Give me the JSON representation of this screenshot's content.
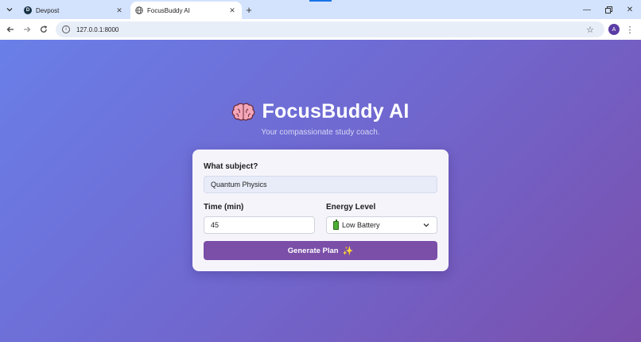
{
  "browser": {
    "tabs": [
      {
        "title": "Devpost",
        "favicon": "devpost-icon"
      },
      {
        "title": "FocusBuddy AI",
        "favicon": "globe-icon"
      }
    ],
    "url": "127.0.0.1:8000",
    "avatar_initial": "A"
  },
  "page": {
    "title": "FocusBuddy AI",
    "title_icon": "brain-icon",
    "subtitle": "Your compassionate study coach.",
    "form": {
      "subject_label": "What subject?",
      "subject_value": "Quantum Physics",
      "time_label": "Time (min)",
      "time_value": "45",
      "energy_label": "Energy Level",
      "energy_value": "Low Battery",
      "energy_icon": "battery-icon",
      "submit_label": "Generate Plan",
      "submit_icon": "sparkle-icon"
    }
  },
  "colors": {
    "gradient_start": "#6a7fe8",
    "gradient_end": "#7a4fac",
    "button": "#7b4ea8",
    "tab_bar": "#d3e3fd"
  }
}
